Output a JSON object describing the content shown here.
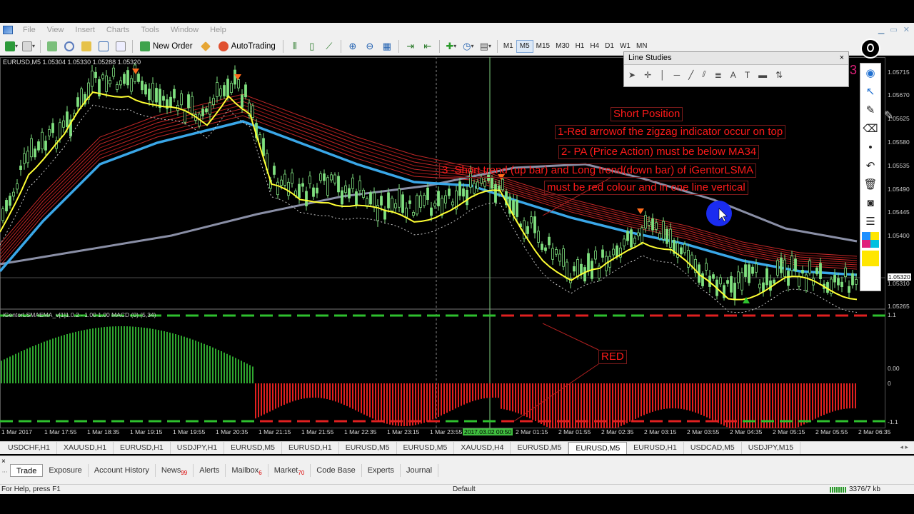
{
  "menu": {
    "items": [
      "File",
      "View",
      "Insert",
      "Charts",
      "Tools",
      "Window",
      "Help"
    ]
  },
  "toolbar": {
    "new_order_label": "New Order",
    "autotrading_label": "AutoTrading",
    "timeframes": [
      "M1",
      "M5",
      "M15",
      "M30",
      "H1",
      "H4",
      "D1",
      "W1",
      "MN"
    ],
    "active_timeframe": "M5"
  },
  "chart": {
    "header": "EURUSD,M5  1.05304 1.05330 1.05288 1.05320",
    "indicator_header": "iGentorLSMAEMA_v[1]1.0.2 - 1.00 1.00  MACD (0) (5,34)",
    "price_labels": [
      "1.05715",
      "1.05670",
      "1.05625",
      "1.05580",
      "1.05535",
      "1.05490",
      "1.05445",
      "1.05400",
      "1.05320",
      "1.05310",
      "1.05265"
    ],
    "indicator_labels": [
      "1.1",
      "0.00",
      "0",
      "-1.1"
    ],
    "current_price": "1.05320",
    "time_labels": [
      "1 Mar 2017",
      "1 Mar 17:55",
      "1 Mar 18:35",
      "1 Mar 19:15",
      "1 Mar 19:55",
      "1 Mar 20:35",
      "1 Mar 21:15",
      "1 Mar 21:55",
      "1 Mar 22:35",
      "1 Mar 23:15",
      "1 Mar 23:55",
      "2017.03.02 00:50",
      "2 Mar 01:15",
      "2 Mar 01:55",
      "2 Mar 02:35",
      "2 Mar 03:15",
      "2 Mar 03:55",
      "2 Mar 04:35",
      "2 Mar 05:15",
      "2 Mar 05:55",
      "2 Mar 06:35"
    ],
    "colors": {
      "bull": "#7fe07f",
      "ema": "#3aa7e8",
      "lsma": "#ffff33",
      "sma": "#8a8fa6",
      "bear_hist": "#e02020",
      "bull_hist": "#2fa82f"
    }
  },
  "annotations": {
    "title": "Short Position",
    "rule1": "1-Red arrowof the zigzag indicator occur on top",
    "rule2": "2- PA (Price Action) must be below MA34",
    "rule3": "3 -Short trend (up bar) and Long trend(down bar) of iGentorLSMA",
    "rule3b": "must be red colour and in one line vertical",
    "red_label": "RED"
  },
  "line_studies": {
    "title": "Line Studies",
    "close": "×"
  },
  "symbol_tabs": [
    "USDCHF,H1",
    "XAUUSD,H1",
    "EURUSD,H1",
    "USDJPY,H1",
    "EURUSD,M5",
    "EURUSD,H1",
    "EURUSD,M5",
    "EURUSD,M5",
    "XAUUSD,H4",
    "EURUSD,M5",
    "EURUSD,M5",
    "EURUSD,H1",
    "USDCAD,M5",
    "USDJPY,M15"
  ],
  "active_symbol_tab": 10,
  "terminal": {
    "tabs": [
      {
        "label": "Trade",
        "badge": ""
      },
      {
        "label": "Exposure",
        "badge": ""
      },
      {
        "label": "Account History",
        "badge": ""
      },
      {
        "label": "News",
        "badge": "99"
      },
      {
        "label": "Alerts",
        "badge": ""
      },
      {
        "label": "Mailbox",
        "badge": "6"
      },
      {
        "label": "Market",
        "badge": "70"
      },
      {
        "label": "Code Base",
        "badge": ""
      },
      {
        "label": "Experts",
        "badge": ""
      },
      {
        "label": "Journal",
        "badge": ""
      }
    ]
  },
  "status": {
    "help": "For Help, press F1",
    "profile": "Default",
    "traffic": "3376/7 kb"
  },
  "logo_number": "3"
}
